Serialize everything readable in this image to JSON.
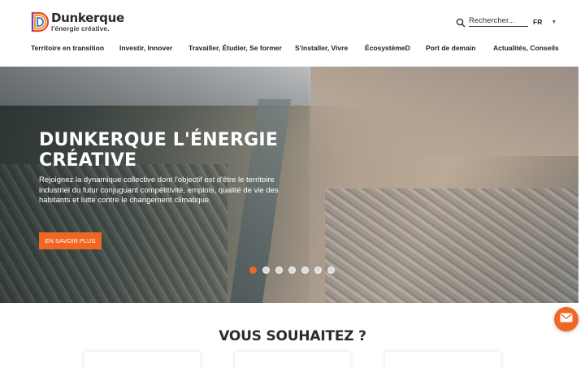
{
  "brand": {
    "title": "Dunkerque",
    "subtitle": "l'énergie créative."
  },
  "header": {
    "search_placeholder": "Rechercher...",
    "language": "FR"
  },
  "nav": {
    "items": [
      {
        "label": "Territoire en transition"
      },
      {
        "label": "Investir, Innover"
      },
      {
        "label": "Travailler, Étudier, Se former"
      },
      {
        "label": "S'installer, Vivre"
      },
      {
        "label": "ÉcosystèmeD"
      },
      {
        "label": "Port de demain"
      },
      {
        "label": "Actualités, Conseils"
      }
    ]
  },
  "hero": {
    "title": "DUNKERQUE L'ÉNERGIE CRÉATIVE",
    "description": "Rejoignez la dynamique collective dont l'objectif est d'être le territoire industriel du futur conjuguant compétitivité, emplois, qualité de vie des habitants et lutte contre le changement climatique.",
    "cta_label": "EN SAVOIR PLUS",
    "slides_total": 7,
    "slide_active": 1
  },
  "section": {
    "title": "VOUS SOUHAITEZ ?"
  },
  "colors": {
    "accent": "#f06723",
    "text": "#222222"
  },
  "icons": {
    "search": "search-icon",
    "mail": "mail-icon",
    "caret": "caret-down-icon"
  }
}
